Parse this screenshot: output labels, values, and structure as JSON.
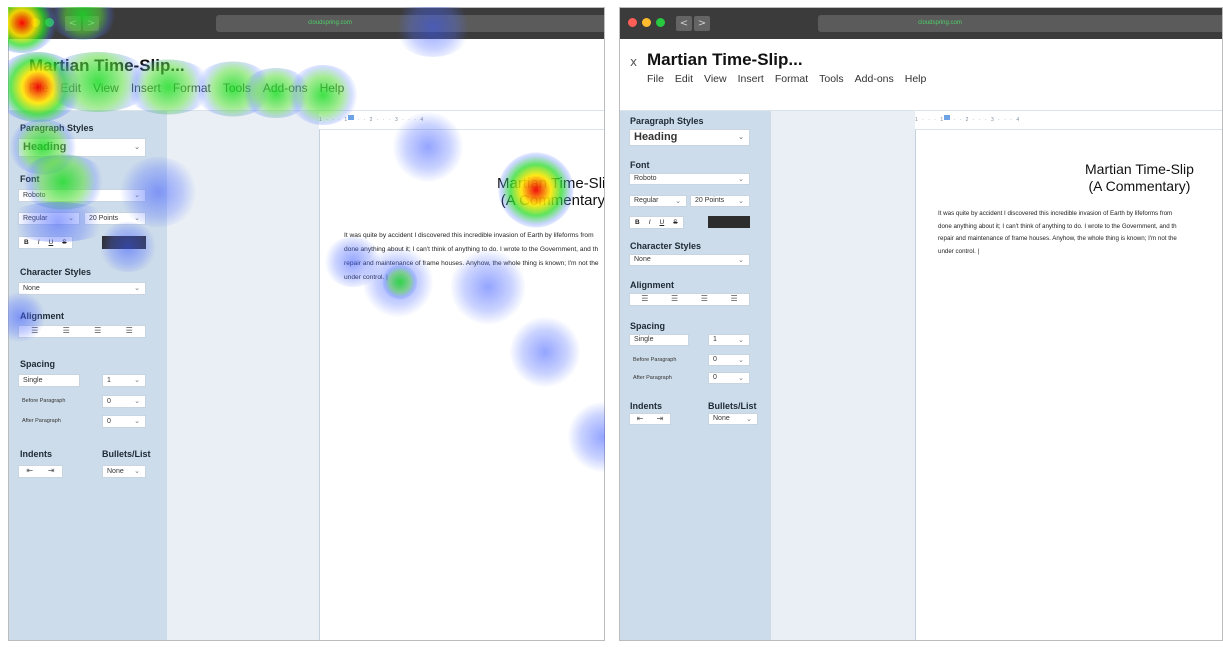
{
  "window": {
    "url": "cloudspring.com",
    "nav_back": "<",
    "nav_forward": ">"
  },
  "header": {
    "close": "x",
    "title": "Martian Time-Slip...",
    "menu": [
      "File",
      "Edit",
      "View",
      "Insert",
      "Format",
      "Tools",
      "Add-ons",
      "Help"
    ]
  },
  "sidebar": {
    "paragraph_styles_label": "Paragraph Styles",
    "paragraph_style": "Heading",
    "font_label": "Font",
    "font": "Roboto",
    "weight": "Regular",
    "size": "20 Points",
    "format_buttons": [
      "B",
      "I",
      "U",
      "S"
    ],
    "character_styles_label": "Character Styles",
    "character_style": "None",
    "alignment_label": "Alignment",
    "spacing_label": "Spacing",
    "line_spacing": "Single",
    "line_spacing_value": "1",
    "before_paragraph_label": "Before Paragraph",
    "before_paragraph": "0",
    "after_paragraph_label": "After Paragraph",
    "after_paragraph": "0",
    "indents_label": "Indents",
    "bullets_label": "Bullets/List",
    "bullets": "None"
  },
  "document": {
    "ruler": "1 · · · 1 · · · 2 · · · 3 · · · 4",
    "heading_line1": "Martian Time-Slip",
    "heading_line2": "(A Commentary)",
    "body_lines": [
      "It was quite by accident I discovered this incredible invasion of Earth by lifeforms from",
      "done anything about it; I can't think of anything to do. I wrote to the Government, and th",
      "repair and maintenance of frame houses. Anyhow, the whole thing is known; I'm not the",
      "under control. |"
    ]
  },
  "colors": {
    "sidebar_bg": "#cddcea",
    "gutter_bg": "#e9eff5",
    "titlebar_bg": "#3b3b3b",
    "url_text": "#4fd06a"
  }
}
